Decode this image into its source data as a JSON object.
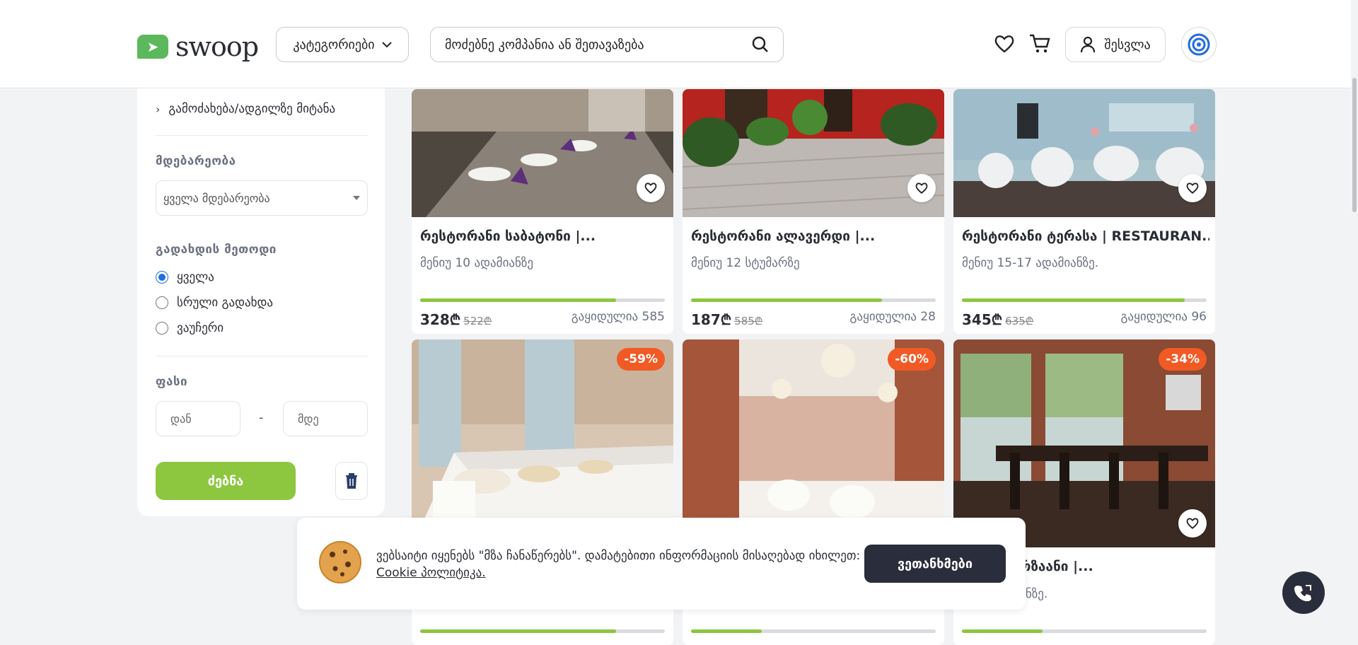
{
  "header": {
    "logo_text": "swoop",
    "categories_label": "კატეგორიები",
    "search_placeholder": "მოძებნე კომპანია ან შეთავაზება",
    "login_label": "შესვლა"
  },
  "sidebar": {
    "link": "გამოძახება/ადგილზე მიტანა",
    "location_title": "მდებარეობა",
    "location_value": "ყველა მდებარეობა",
    "payment_title": "გადახდის მეთოდი",
    "payment_options": [
      "ყველა",
      "სრული გადახდა",
      "ვაუჩერი"
    ],
    "price_title": "ფასი",
    "price_from_placeholder": "დან",
    "price_to_placeholder": "მდე",
    "dash": "-",
    "search_button": "ძებნა"
  },
  "cards_top": [
    {
      "title": "რესტორანი საბატონი |...",
      "subtitle": "მენიუ 10 ადამიანზე",
      "price": "328₾",
      "old_price": "522₾",
      "sold": "გაყიდულია 585",
      "progress": 0.8
    },
    {
      "title": "რესტორანი ალავერდი |...",
      "subtitle": "მენიუ 12 სტუმარზე",
      "price": "187₾",
      "old_price": "585₾",
      "sold": "გაყიდულია 28",
      "progress": 0.78
    },
    {
      "title": "რესტორანი ტერასა | RESTAURAN...",
      "subtitle": "მენიუ 15-17 ადამიანზე.",
      "price": "345₾",
      "old_price": "635₾",
      "sold": "გაყიდულია 96",
      "progress": 0.91
    }
  ],
  "cards_bottom": [
    {
      "discount": "-59%",
      "progress": 0.8
    },
    {
      "discount": "-60%",
      "progress": 0.29
    },
    {
      "discount": "-34%",
      "title": "...ანი მირზაანი |...",
      "subtitle": "...2 ადამიანზე.",
      "progress": 0.33
    }
  ],
  "cookie": {
    "text": "ვებსაიტი იყენებს \"მზა ჩანაწერებს\". დამატებითი ინფორმაციის მისაღებად იხილეთ:",
    "link": "Cookie პოლიტიკა.",
    "button": "ვეთანხმები"
  }
}
